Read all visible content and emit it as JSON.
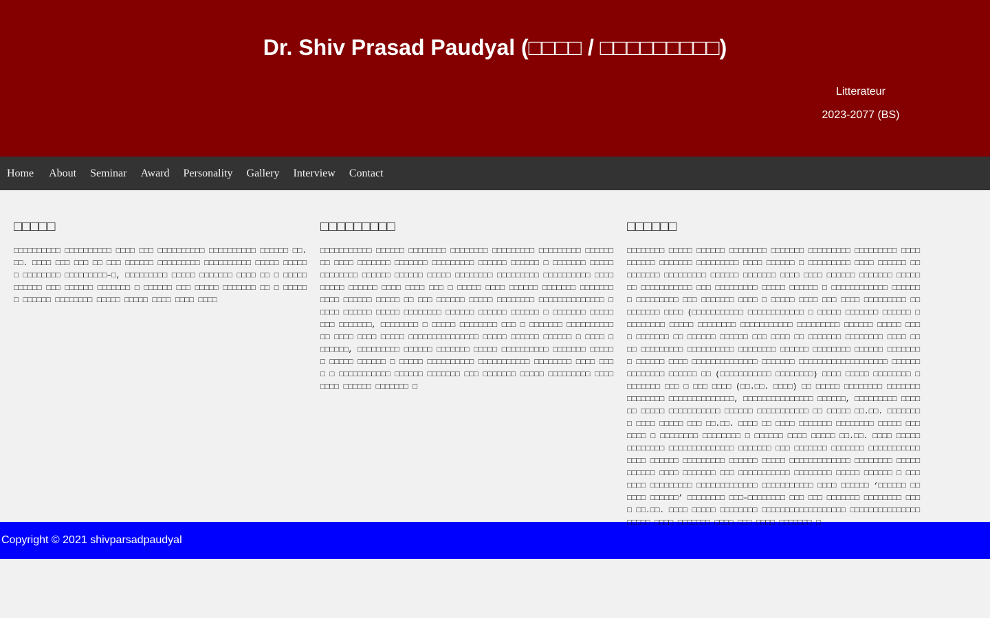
{
  "header": {
    "title": "Dr. Shiv Prasad Paudyal (□□□□ / □□□□□□□□□)",
    "tagline": "Litterateur",
    "years": "2023-2077 (BS)"
  },
  "nav": {
    "items": [
      {
        "label": "Home"
      },
      {
        "label": "About"
      },
      {
        "label": "Seminar"
      },
      {
        "label": "Award"
      },
      {
        "label": "Personality"
      },
      {
        "label": "Gallery"
      },
      {
        "label": "Interview"
      },
      {
        "label": "Contact"
      }
    ]
  },
  "columns": [
    {
      "heading": "□□□□□",
      "text": "□□□□□□□□□□ □□□□□□□□□□ □□□□ □□□ □□□□□□□□□□ □□□□□□□□□□ □□□□□□ □□.□□. □□□□ □□□ □□□ □□ □□□ □□□□□□ □□□□□□□□□ □□□□□□□□□□ □□□□□ □□□□□□ □□□□□□□□ □□□□□□□□□–□, □□□□□□□□□ □□□□□ □□□□□□□ □□□□ □□ □ □□□□□ □□□□□□ □□□ □□□□□□ □□□□□□□ □ □□□□□□ □□□ □□□□□ □□□□□□□ □□ □ □□□□□□ □□□□□□ □□□□□□□□ □□□□□ □□□□□ □□□□ □□□□ □□□□"
    },
    {
      "heading": "□□□□□□□□□",
      "text": "□□□□□□□□□□□ □□□□□□ □□□□□□□□ □□□□□□□□ □□□□□□□□□ □□□□□□□□□ □□□□□□□□ □□□□ □□□□□□□ □□□□□□□ □□□□□□□□□ □□□□□□ □□□□□□ □ □□□□□□□ □□□□□□□□□□□□□ □□□□□□ □□□□□□ □□□□□ □□□□□□□□ □□□□□□□□□ □□□□□□□□□□ □□□□□□□□□ □□□□□□ □□□□ □□□□ □□□ □ □□□□□ □□□□ □□□□□□ □□□□□□□ □□□□□□□ □□□□ □□□□□□ □□□□□ □□ □□□ □□□□□□ □□□□□ □□□□□□□□ □□□□□□□□□□□□□□ □□□□□ □□□□□□ □□□□□ □□□□□□□□ □□□□□□ □□□□□□ □□□□□□ □ □□□□□□□ □□□□□□□□ □□□□□□□, □□□□□□□□ □ □□□□□ □□□□□□□□ □□□ □ □□□□□□□ □□□□□□□□□□□□ □□□□ □□□□ □□□□□ □□□□□□□□□□□□□□□ □□□□□ □□□□□□ □□□□□□ □ □□□□ □□□□□□□, □□□□□□□□□ □□□□□□ □□□□□□□ □□□□□ □□□□□□□□□□ □□□□□□□ □□□□□□ □□□□□ □□□□□□ □ □□□□□ □□□□□□□□□□ □□□□□□□□□□□ □□□□□□□□ □□□□ □□□□ □ □□□□□□□□□□□ □□□□□□ □□□□□□□ □□□ □□□□□□□ □□□□□ □□□□□□□□□ □□□□□□□□ □□□□□□ □□□□□□□ □"
    },
    {
      "heading": "□□□□□□",
      "text": "□□□□□□□□ □□□□□ □□□□□□ □□□□□□□□ □□□□□□□ □□□□□□□□□ □□□□□□□□□ □□□□□□□□□□ □□□□□□□ □□□□□□□□□ □□□□ □□□□□□ □ □□□□□□□□□ □□□□ □□□□□□ □□□□□□□□□ □□□□□□□□□ □□□□□□ □□□□□□□ □□□□ □□□□ □□□□□□ □□□□□□□ □□□□□□□ □□□□□□□□□□□ □□□ □□□□□□□□□ □□□□□ □□□□□□ □ □□□□□□□□□□□□ □□□□□□□ □□□□□□□□□ □□□ □□□□□□□ □□□□ □ □□□□□ □□□□ □□□ □□□□ □□□□□□□□□ □□□□□□□□□ □□□□ (□□□□□□□□□□□ □□□□□□□□□□□□ □ □□□□□ □□□□□□□ □□□□□□ □□□□□□□□□ □□□□□ □□□□□□□□ □□□□□□□□□□□ □□□□□□□□□ □□□□□□ □□□□□ □□□ □ □□□□□□□ □□ □□□□□□ □□□□□□ □□□ □□□□ □□ □□□□□□□ □□□□□□□□ □□□□ □□□□ □□□□□□□□□ □□□□□□□□□□ □□□□□□□□ □□□□□□ □□□□□□□□ □□□□□□ □□□□□□□ □ □□□□□□ □□□□ □□□□□□□□□□□□□□ □□□□□□□ □□□□□□□□□□□□□□□□□□□ □□□□□□□□□□□□□□ □□□□□□ □□ (□□□□□□□□□□□ □□□□□□□□) □□□□ □□□□□ □□□□□□□□ □□□□□□□□ □□□ □ □□□ □□□□ (□□.□□. □□□□) □□ □□□□□ □□□□□□□□ □□□□□□□ □□□□□□□□ □□□□□□□□□□□□□□, □□□□□□□□□□□□□□□ □□□□□□, □□□□□□□□□ □□□□□□ □□□□□ □□□□□□□□□□□ □□□□□□ □□□□□□□□□□□ □□ □□□□□ □□.□□. □□□□□□□□ □□□□ □□□□□ □□□ □□.□□. □□□□ □□ □□□□ □□□□□□□ □□□□□□□□ □□□□□ □□□□□□□ □ □□□□□□□□ □□□□□□□□ □ □□□□□□ □□□□ □□□□□ □□.□□. □□□□ □□□□□ □□□□□□□□ □□□□□□□□□□□□□□ □□□□□□□ □□□ □□□□□□□ □□□□□□□ □□□□□□□□□□□□□□□ □□□□□□ □□□□□□□□□ □□□□□□ □□□□□ □□□□□□□□□□□□□ □□□□□□□□ □□□□□ □□□□□□ □□□□ □□□□□□□ □□□ □□□□□□□□□□□ □□□□□□□□ □□□□□ □□□□□□ □ □□□□□□□ □□□□□□□□□ □□□□□□□□□□□□□ □□□□□□□□□□□ □□□□ □□□□□□ ‘□□□□□□ □□□□□□ □□□□□□’ □□□□□□□□ □□□–□□□□□□□□ □□□ □□□ □□□□□□□ □□□□□□□□ □□□□ □□.□□. □□□□ □□□□□ □□□□□□□□ □□□□□□□□□□□□□□□□□□ □□□□□□□□□□□□□□□ □□□□□ □□□□ □□□□□□□ □□□□ □□□ □□□□ □□□□□□□ □"
    }
  ],
  "footer": {
    "copyright": "Copyright © 2021 shivparsadpaudyal"
  }
}
